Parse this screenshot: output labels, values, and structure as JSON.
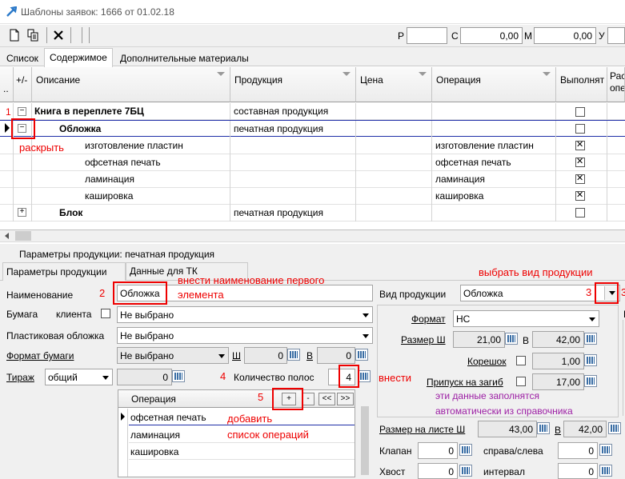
{
  "window": {
    "title": "Шаблоны заявок: 1666 от 01.02.18"
  },
  "totals": {
    "r_label": "Р",
    "r_value": "",
    "c_label": "С",
    "c_value": "0,00",
    "m_label": "М",
    "m_value": "0,00",
    "u_label": "У",
    "u_value": ""
  },
  "tabs": [
    "Список",
    "Содержимое",
    "Дополнительные материалы"
  ],
  "grid": {
    "columns": [
      "+/-",
      "Описание",
      "Продукция",
      "Цена",
      "Операция",
      "Выполнят",
      "Рас опе"
    ],
    "rows": [
      {
        "desc": "Книга в переплете 7БЦ",
        "product": "составная продукция",
        "operation": "",
        "done": false
      },
      {
        "desc": "Обложка",
        "product": "печатная продукция",
        "operation": "",
        "done": false
      },
      {
        "desc": "изготовление пластин",
        "product": "",
        "operation": "изготовление пластин",
        "done": true
      },
      {
        "desc": "офсетная печать",
        "product": "",
        "operation": "офсетная печать",
        "done": true
      },
      {
        "desc": "ламинация",
        "product": "",
        "operation": "ламинация",
        "done": true
      },
      {
        "desc": "кашировка",
        "product": "",
        "operation": "кашировка",
        "done": true
      },
      {
        "desc": "Блок",
        "product": "печатная продукция",
        "operation": "",
        "done": false
      }
    ]
  },
  "params": {
    "title": "Параметры продукции: печатная продукция",
    "tabs": [
      "Параметры продукции",
      "Данные для ТК"
    ],
    "name_label": "Наименование",
    "name_value": "Обложка",
    "paper_label": "Бумага",
    "client_label": "клиента",
    "paper_value": "Не выбрано",
    "plastic_label": "Пластиковая обложка",
    "plastic_value": "Не выбрано",
    "format_label": "Формат бумаги",
    "format_value": "Не выбрано",
    "w_label": "Ш",
    "w_value": "0",
    "h_label": "В",
    "h_value": "0",
    "run_label": "Тираж",
    "run_type": "общий",
    "run_value": "0",
    "strips_label": "Количество полос",
    "strips_value": "4",
    "product_type_label": "Вид продукции",
    "product_type_value": "Обложка",
    "pformat_label": "Формат",
    "pformat_value": "НС",
    "size_label": "Размер Ш",
    "size_w": "21,00",
    "size_h_label": "В",
    "size_h": "42,00",
    "spine_label": "Корешок",
    "spine_value": "1,00",
    "fold_label": "Припуск на загиб",
    "fold_value": "17,00",
    "sheet_label": "Размер на листе Ш",
    "sheet_w": "43,00",
    "sheet_h_label": "В",
    "sheet_h": "42,00",
    "flap_label": "Клапан",
    "flap_value": "0",
    "side_label": "справа/слева",
    "side_value": "0",
    "tail_label": "Хвост",
    "tail_value": "0",
    "interval_label": "интервал",
    "interval_value": "0",
    "right_cut": "Е"
  },
  "operations": {
    "header": "Операция",
    "buttons": [
      "+",
      "-",
      "<<",
      ">>"
    ],
    "items": [
      "офсетная печать",
      "ламинация",
      "кашировка"
    ]
  },
  "annotations": {
    "n1": "1",
    "expand": "раскрыть",
    "n2": "2",
    "enter_name": "внести наименование первого элемента",
    "enter_name_1": "внести наименование первого",
    "enter_name_2": "элемента",
    "choose_type": "выбрать вид продукции",
    "n3": "3",
    "n3b": "3",
    "n4": "4",
    "enter": "внести",
    "n5": "5",
    "add": "добавить",
    "op_list": "список операций",
    "auto_1": "эти данные заполнятся",
    "auto_2": "автоматически из справочника"
  },
  "colors": {
    "annotation": "#ee0000",
    "auto_note": "#9c1ea4",
    "row_line": "#1f2fa8"
  }
}
